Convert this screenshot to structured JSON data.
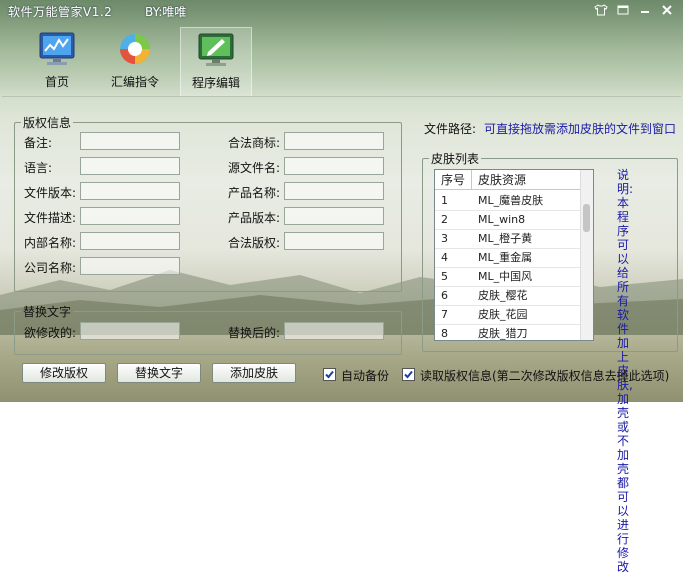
{
  "app": {
    "title": "软件万能管家V1.2",
    "author": "BY:唯唯"
  },
  "nav": [
    {
      "label": "首页",
      "icon": "monitor-chart-icon"
    },
    {
      "label": "汇编指令",
      "icon": "refresh-globe-icon"
    },
    {
      "label": "程序编辑",
      "icon": "monitor-edit-icon"
    }
  ],
  "copyright_group": {
    "legend": "版权信息",
    "left_fields": [
      {
        "label": "备注:",
        "value": ""
      },
      {
        "label": "语言:",
        "value": ""
      },
      {
        "label": "文件版本:",
        "value": ""
      },
      {
        "label": "文件描述:",
        "value": ""
      },
      {
        "label": "内部名称:",
        "value": ""
      },
      {
        "label": "公司名称:",
        "value": ""
      }
    ],
    "right_fields": [
      {
        "label": "合法商标:",
        "value": ""
      },
      {
        "label": "源文件名:",
        "value": ""
      },
      {
        "label": "产品名称:",
        "value": ""
      },
      {
        "label": "产品版本:",
        "value": ""
      },
      {
        "label": "合法版权:",
        "value": ""
      }
    ]
  },
  "replace_group": {
    "legend": "替换文字",
    "before_label": "欲修改的:",
    "after_label": "替换后的:"
  },
  "file_path": {
    "label": "文件路径:",
    "hint": "可直接拖放需添加皮肤的文件到窗口"
  },
  "skin_list": {
    "legend": "皮肤列表",
    "columns": [
      "序号",
      "皮肤资源"
    ],
    "rows": [
      {
        "no": "1",
        "name": "ML_魔兽皮肤"
      },
      {
        "no": "2",
        "name": "ML_win8"
      },
      {
        "no": "3",
        "name": "ML_橙子黄"
      },
      {
        "no": "4",
        "name": "ML_重金属"
      },
      {
        "no": "5",
        "name": "ML_中国风"
      },
      {
        "no": "6",
        "name": "皮肤_樱花"
      },
      {
        "no": "7",
        "name": "皮肤_花园"
      },
      {
        "no": "8",
        "name": "皮肤_猎刀"
      }
    ]
  },
  "note": "说明:本程序可以给所有软件加上皮肤,加壳或不加壳都可以进行修改",
  "buttons": {
    "modify": "修改版权",
    "replace": "替换文字",
    "add_skin": "添加皮肤"
  },
  "checkboxes": {
    "auto_backup": {
      "label": "自动备份",
      "checked": true
    },
    "read_info": {
      "label": "读取版权信息(第二次修改版权信息去掉此选项)",
      "checked": true
    }
  },
  "colors": {
    "accent_text": "#1a1aa6"
  }
}
